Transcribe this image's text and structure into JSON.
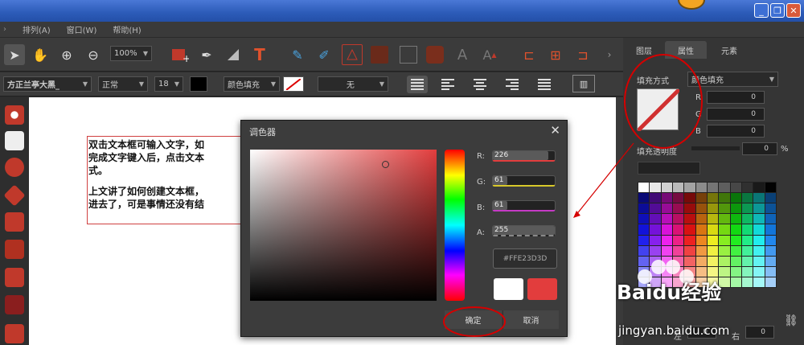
{
  "menubar": {
    "items": [
      "排列(A)",
      "窗口(W)",
      "帮助(H)"
    ]
  },
  "toolbar1": {
    "zoom": "100%"
  },
  "toolbar2": {
    "font": "方正兰亭大黑_",
    "style": "正常",
    "size": "18",
    "fill_mode": "颜色填充",
    "stroke_mode": "无"
  },
  "canvas": {
    "lines": [
      "双击文本框可输入文字，如",
      "完成文字键入后，点击文本",
      "式。",
      "上文讲了如何创建文本框，",
      "进去了，可是事情还没有结"
    ]
  },
  "panel": {
    "tabs": [
      "图层",
      "属性",
      "元素"
    ],
    "fill_label": "填充方式",
    "fill_value": "颜色填充",
    "r_label": "R",
    "r_value": "0",
    "g_label": "G",
    "g_value": "0",
    "b_label": "B",
    "b_value": "0",
    "opacity_label": "填充透明度",
    "opacity_value": "0",
    "opacity_unit": "%",
    "left_label": "左",
    "left_value": "0",
    "right_label": "右",
    "right_value": "0"
  },
  "dialog": {
    "title": "调色器",
    "close": "✕",
    "r_label": "R:",
    "r_value": "226",
    "g_label": "G:",
    "g_value": "61",
    "b_label": "B:",
    "b_value": "61",
    "a_label": "A:",
    "a_value": "255",
    "hex": "#FFE23D3D",
    "ok": "确定",
    "cancel": "取消",
    "color": "#e23d3d",
    "r_fraction": 0.89,
    "g_fraction": 0.24,
    "b_fraction": 0.24,
    "a_fraction": 1.0
  },
  "watermark": {
    "brand": "Baidu经验",
    "url": "jingyan.baidu.com"
  },
  "colors": {
    "accent": "#e23d3d",
    "annotation": "#d50000"
  }
}
